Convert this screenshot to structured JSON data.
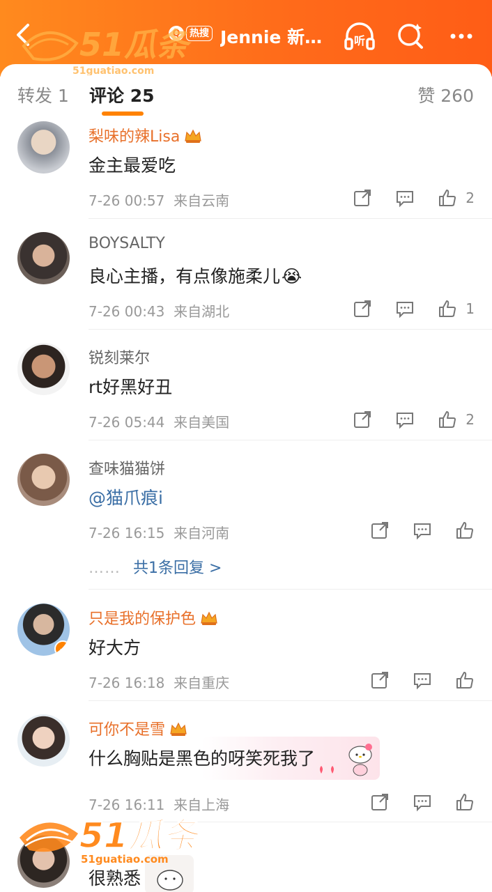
{
  "header": {
    "title": "Jennie 新…",
    "hot_label": "热搜",
    "icons": [
      "back-icon",
      "listen-icon",
      "search-icon",
      "more-icon"
    ],
    "listen_label": "听"
  },
  "watermark": {
    "brand": "51瓜条",
    "url": "51guatiao.com"
  },
  "tabs": {
    "repost": "转发 1",
    "comment": "评论 25",
    "like": "赞 260"
  },
  "comments": [
    {
      "user": "梨味的辣Lisa",
      "badge": true,
      "text": "金主最爱吃",
      "time": "7-26 00:57",
      "location": "来自云南",
      "likes": "2"
    },
    {
      "user": "BOYSALTY",
      "badge": false,
      "text": "良心主播，有点像施柔儿",
      "emoji": "😭",
      "time": "7-26 00:43",
      "location": "来自湖北",
      "likes": "1"
    },
    {
      "user": "锐刻莱尔",
      "badge": false,
      "text": "rt好黑好丑",
      "time": "7-26 05:44",
      "location": "来自美国",
      "likes": "2"
    },
    {
      "user": "查味猫猫饼",
      "badge": false,
      "text": "@猫爪痕i",
      "time": "7-26 16:15",
      "location": "来自河南",
      "likes": "",
      "reply": "共1条回复 >",
      "reply_dots": "……"
    },
    {
      "user": "只是我的保护色",
      "badge": true,
      "verified": true,
      "text": "好大方",
      "time": "7-26 16:18",
      "location": "来自重庆",
      "likes": ""
    },
    {
      "user": "可你不是雪",
      "badge": true,
      "text": "什么胸贴是黑色的呀笑死我了",
      "time": "7-26 16:11",
      "location": "来自上海",
      "likes": ""
    },
    {
      "user": "",
      "badge": true,
      "text": "很熟悉",
      "time": "",
      "location": "",
      "likes": ""
    }
  ],
  "colors": {
    "brand_orange": "#ff8200",
    "gold_name": "#e8702a",
    "link_blue": "#3a6ea5"
  }
}
